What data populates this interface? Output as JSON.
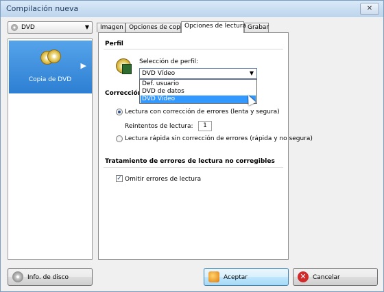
{
  "window": {
    "title": "Compilación nueva",
    "close_glyph": "✕"
  },
  "disc_type": {
    "selected": "DVD",
    "icon": "disc-icon"
  },
  "left_panel": {
    "items": [
      {
        "label": "Copia de DVD",
        "icon": "gold-disc-icon"
      }
    ]
  },
  "tabs": [
    "Imagen",
    "Opciones de copia",
    "Opciones de lectura",
    "Grabar"
  ],
  "active_tab": "Opciones de lectura",
  "perfil": {
    "heading": "Perfil",
    "label": "Selección de perfil:",
    "selected": "DVD Vídeo",
    "options": [
      "Def. usuario",
      "DVD de datos",
      "DVD Vídeo"
    ],
    "highlighted_option": "DVD Vídeo"
  },
  "correccion": {
    "heading_visible": "Corrección",
    "radio_safe": "Lectura con corrección de errores (lenta y segura)",
    "retries_label": "Reintentos de lectura:",
    "retries_value": "1",
    "radio_fast": "Lectura rápida sin corrección de errores (rápida y no segura)",
    "selected": "safe"
  },
  "tratamiento": {
    "heading": "Tratamiento de errores de lectura no corregibles",
    "checkbox_label": "Omitir errores de lectura",
    "checked": true
  },
  "buttons": {
    "info": "Info. de disco",
    "accept": "Aceptar",
    "cancel": "Cancelar"
  },
  "colors": {
    "selection_blue": "#3399ff",
    "left_item_blue": "#2d7fd3"
  }
}
